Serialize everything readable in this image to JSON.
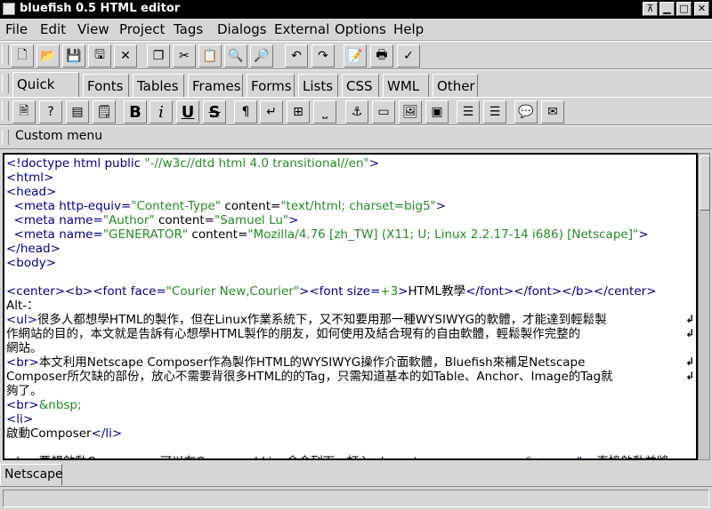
{
  "window": {
    "title": "bluefish 0.5 HTML editor",
    "controls": [
      "⊼",
      "▁",
      "□",
      "✕"
    ]
  },
  "menu": [
    "File",
    "Edit",
    "View",
    "Project",
    "Tags",
    "Dialogs",
    "External",
    "Options",
    "Help"
  ],
  "tabs": [
    "Quick bar",
    "Fonts",
    "Tables",
    "Frames",
    "Forms",
    "Lists",
    "CSS",
    "WML",
    "Other"
  ],
  "quickbar": {
    "bold": "B",
    "italic": "i",
    "underline": "U",
    "strike": "S"
  },
  "custom_menu": "Custom menu",
  "editor_lines": [
    [
      [
        "t",
        "<!doctype html public "
      ],
      [
        "v",
        "\"-//w3c//dtd html 4.0 transitional//en\""
      ],
      [
        "t",
        ">"
      ]
    ],
    [
      [
        "t",
        "<html>"
      ]
    ],
    [
      [
        "t",
        "<head>"
      ]
    ],
    [
      [
        "t",
        "  <meta http-equiv="
      ],
      [
        "v",
        "\"Content-Type\""
      ],
      [
        "a",
        " content="
      ],
      [
        "v",
        "\"text/html; charset=big5\""
      ],
      [
        "t",
        ">"
      ]
    ],
    [
      [
        "t",
        "  <meta name="
      ],
      [
        "v",
        "\"Author\""
      ],
      [
        "a",
        " content="
      ],
      [
        "v",
        "\"Samuel Lu\""
      ],
      [
        "t",
        ">"
      ]
    ],
    [
      [
        "t",
        "  <meta name="
      ],
      [
        "v",
        "\"GENERATOR\""
      ],
      [
        "a",
        " content="
      ],
      [
        "v",
        "\"Mozilla/4.76 [zh_TW] (X11; U; Linux 2.2.17-14 i686) [Netscape]\""
      ],
      [
        "t",
        ">"
      ]
    ],
    [
      [
        "t",
        "</head>"
      ]
    ],
    [
      [
        "t",
        "<body>"
      ]
    ],
    [],
    [
      [
        "t",
        "<center><b><font face="
      ],
      [
        "v",
        "\"Courier New,Courier\""
      ],
      [
        "t",
        "><font size="
      ],
      [
        "v",
        "+3"
      ],
      [
        "t",
        ">"
      ],
      [
        "x",
        "HTML教學"
      ],
      [
        "t",
        "</font></font></b></center>"
      ]
    ],
    [
      [
        "x",
        "Alt-："
      ]
    ],
    [
      [
        "t",
        "<ul>"
      ],
      [
        "x",
        "很多人都想學HTML的製作，但在Linux作業系統下，又不知要用那一種WYSIWYG的軟體，才能達到輕鬆製"
      ]
    ],
    [
      [
        "x",
        "作網站的目的，本文就是告訴有心想學HTML製作的朋友，如何使用及結合現有的自由軟體，輕鬆製作完整的"
      ]
    ],
    [
      [
        "x",
        "網站。"
      ]
    ],
    [
      [
        "t",
        "<br>"
      ],
      [
        "x",
        "本文利用Netscape Composer作為製作HTML的WYSIWYG操作介面軟體，Bluefish來補足Netscape"
      ]
    ],
    [
      [
        "x",
        "Composer所欠缺的部份，放心不需要背很多HTML的的Tag，只需知道基本的如Table、Anchor、Image的Tag就"
      ]
    ],
    [
      [
        "x",
        "夠了。"
      ]
    ],
    [
      [
        "t",
        "<br>"
      ],
      [
        "v",
        "&nbsp;"
      ]
    ],
    [
      [
        "t",
        "<li>"
      ]
    ],
    [
      [
        "x",
        "啟動Composer"
      ],
      [
        "t",
        "</li>"
      ]
    ],
    [],
    [
      [
        "t",
        "<br>"
      ],
      [
        "x",
        "要想啟動Composer，可以在Command Line命令列下，打入"
      ],
      [
        "t",
        "<b>"
      ],
      [
        "x",
        "netscape  -composer"
      ],
      [
        "v",
        "&amp;"
      ],
      [
        "t",
        "</b>"
      ],
      [
        "x",
        "直接啟動並將"
      ]
    ]
  ],
  "wrapped_line_indices": [
    11,
    12,
    14,
    15
  ],
  "bottom_tab": "Netscape",
  "status_text": ""
}
